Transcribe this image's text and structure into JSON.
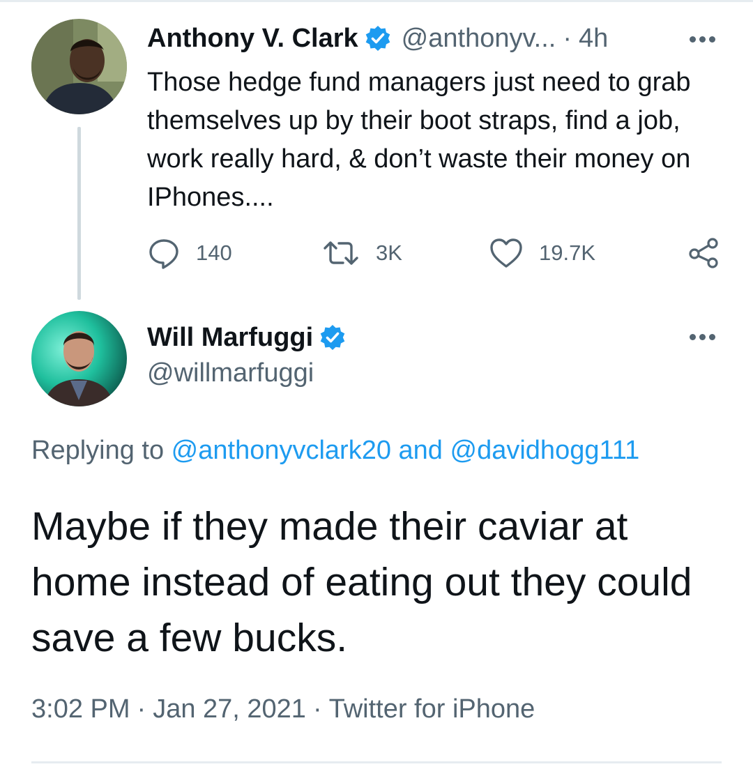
{
  "parent_tweet": {
    "display_name": "Anthony V. Clark",
    "handle": "@anthonyv...",
    "separator": "·",
    "time_ago": "4h",
    "text": "Those hedge fund managers just need to grab themselves up by their boot straps, find a  job, work really hard, & don’t waste their money on IPhones....",
    "reply_count": "140",
    "retweet_count": "3K",
    "like_count": "19.7K"
  },
  "main_tweet": {
    "display_name": "Will Marfuggi",
    "handle": "@willmarfuggi",
    "replying_prefix": "Replying to ",
    "reply_mention_1": "@anthonyvclark20",
    "reply_joiner": " and ",
    "reply_mention_2": "@davidhogg111",
    "text": "Maybe if they made their caviar at home instead of eating out they could  save a few bucks.",
    "time": "3:02 PM",
    "date": "Jan 27, 2021",
    "source": "Twitter for iPhone",
    "separator": "·"
  },
  "icons": {
    "verified": "verified-badge-icon",
    "more": "more-options-icon",
    "reply": "reply-icon",
    "retweet": "retweet-icon",
    "like": "heart-icon",
    "share": "share-icon"
  },
  "colors": {
    "link": "#1d9bf0",
    "secondary_text": "#536471",
    "primary_text": "#0f1419",
    "thread_line": "#cfd9de"
  }
}
